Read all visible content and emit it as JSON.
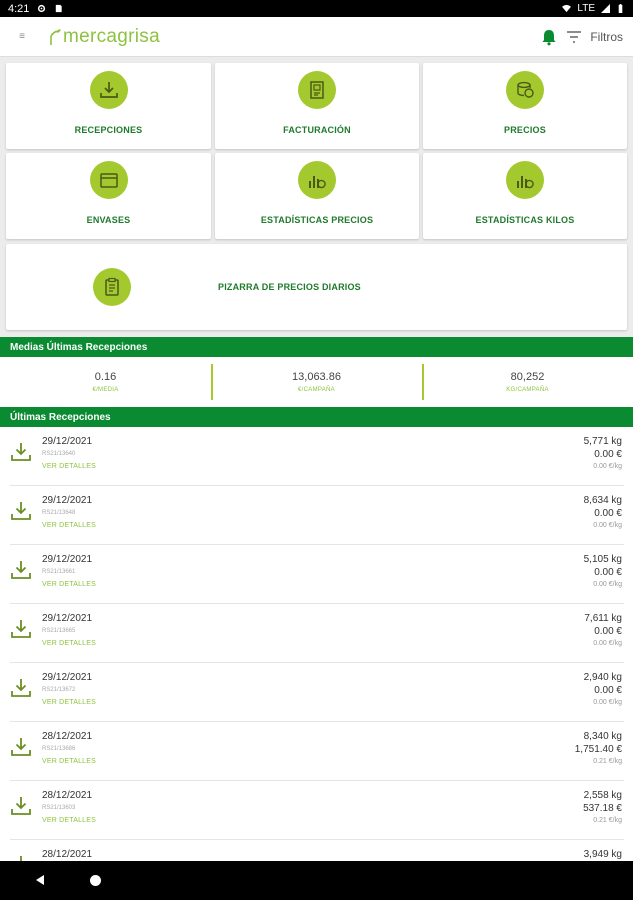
{
  "status_bar": {
    "time": "4:21",
    "network": "LTE"
  },
  "app": {
    "brand": "mercagrisa",
    "filter_label": "Filtros"
  },
  "tiles": [
    {
      "label": "RECEPCIONES",
      "icon": "download-icon"
    },
    {
      "label": "FACTURACIÓN",
      "icon": "invoice-icon"
    },
    {
      "label": "PRECIOS",
      "icon": "price-coins-icon"
    },
    {
      "label": "ENVASES",
      "icon": "container-box-icon"
    },
    {
      "label": "ESTADÍSTICAS PRECIOS",
      "icon": "price-statistics-icon"
    },
    {
      "label": "ESTADÍSTICAS KILOS",
      "icon": "kilo-statistics-icon"
    },
    {
      "label": "PIZARRA DE PRECIOS DIARIOS",
      "icon": "clipboard-icon"
    }
  ],
  "averages": {
    "title": "Medias Últimas Recepciones",
    "items": [
      {
        "value": "0.16",
        "label": "€/MEDIA"
      },
      {
        "value": "13,063.86",
        "label": "€/CAMPAÑA"
      },
      {
        "value": "80,252",
        "label": "KG/CAMPAÑA"
      }
    ]
  },
  "receptions": {
    "title": "Últimas Recepciones",
    "details_label": "VER DETALLES",
    "items": [
      {
        "date": "29/12/2021",
        "code": "RS21/13640",
        "kg": "5,771 kg",
        "eur": "0.00 €",
        "eur_kg": "0.00 €/kg"
      },
      {
        "date": "29/12/2021",
        "code": "RS21/13648",
        "kg": "8,634 kg",
        "eur": "0.00 €",
        "eur_kg": "0.00 €/kg"
      },
      {
        "date": "29/12/2021",
        "code": "RS21/13661",
        "kg": "5,105 kg",
        "eur": "0.00 €",
        "eur_kg": "0.00 €/kg"
      },
      {
        "date": "29/12/2021",
        "code": "RS21/13665",
        "kg": "7,611 kg",
        "eur": "0.00 €",
        "eur_kg": "0.00 €/kg"
      },
      {
        "date": "29/12/2021",
        "code": "RS21/13672",
        "kg": "2,940 kg",
        "eur": "0.00 €",
        "eur_kg": "0.00 €/kg"
      },
      {
        "date": "28/12/2021",
        "code": "RS21/13686",
        "kg": "8,340 kg",
        "eur": "1,751.40 €",
        "eur_kg": "0.21 €/kg"
      },
      {
        "date": "28/12/2021",
        "code": "RS21/13603",
        "kg": "2,558 kg",
        "eur": "537.18 €",
        "eur_kg": "0.21 €/kg"
      },
      {
        "date": "28/12/2021",
        "code": "",
        "kg": "3,949 kg",
        "eur": "",
        "eur_kg": ""
      }
    ]
  },
  "colors": {
    "primary_green": "#0a8a31",
    "accent_lime": "#a4c92f",
    "brand_green": "#8dc23f"
  }
}
